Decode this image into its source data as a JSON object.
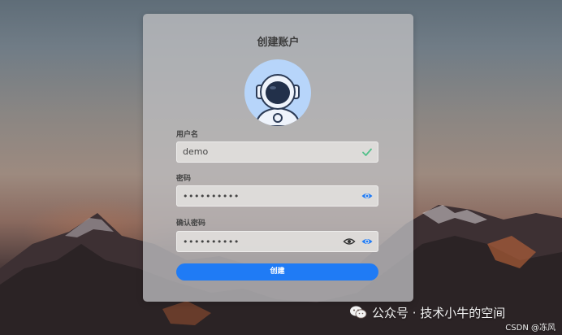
{
  "background": {
    "description_colors": [
      "#5f6d78",
      "#9d8a7f",
      "#2a2426"
    ]
  },
  "form": {
    "title": "创建账户",
    "avatar_icon": "astronaut-avatar",
    "username": {
      "label": "用户名",
      "value": "demo",
      "status_icon": "check-icon"
    },
    "password": {
      "label": "密码",
      "value": "••••••••••",
      "toggle_icon": "eye-icon"
    },
    "confirm_password": {
      "label": "确认密码",
      "value": "••••••••••",
      "icons": [
        "eye-outline-icon",
        "eye-icon"
      ]
    },
    "submit_label": "创建",
    "accent_color": "#1f7bf5"
  },
  "watermark": {
    "text": "公众号 · 技术小牛的空间",
    "icon": "wechat-icon"
  },
  "credit": "CSDN @冻风"
}
